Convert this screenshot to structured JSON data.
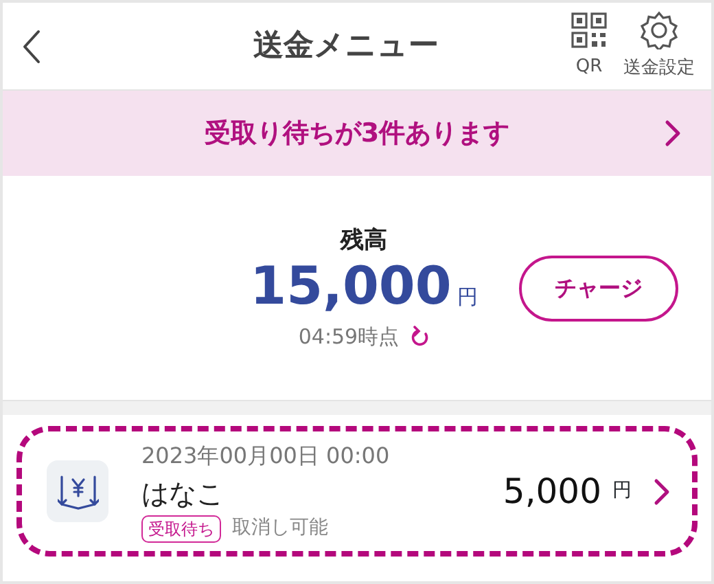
{
  "header": {
    "title": "送金メニュー",
    "actions": [
      {
        "kind": "qr",
        "label": "QR"
      },
      {
        "kind": "settings",
        "label": "送金設定"
      }
    ]
  },
  "notice": {
    "text": "受取り待ちが3件あります"
  },
  "balance": {
    "label": "残高",
    "amount": "15,000",
    "unit": "円",
    "updated": "04:59時点",
    "charge_button": "チャージ"
  },
  "transactions": [
    {
      "date": "2023年00月00日 00:00",
      "name": "はなこ",
      "amount": "5,000",
      "unit": "円",
      "status": "受取待ち",
      "note": "取消し可能",
      "highlighted": true
    }
  ]
}
